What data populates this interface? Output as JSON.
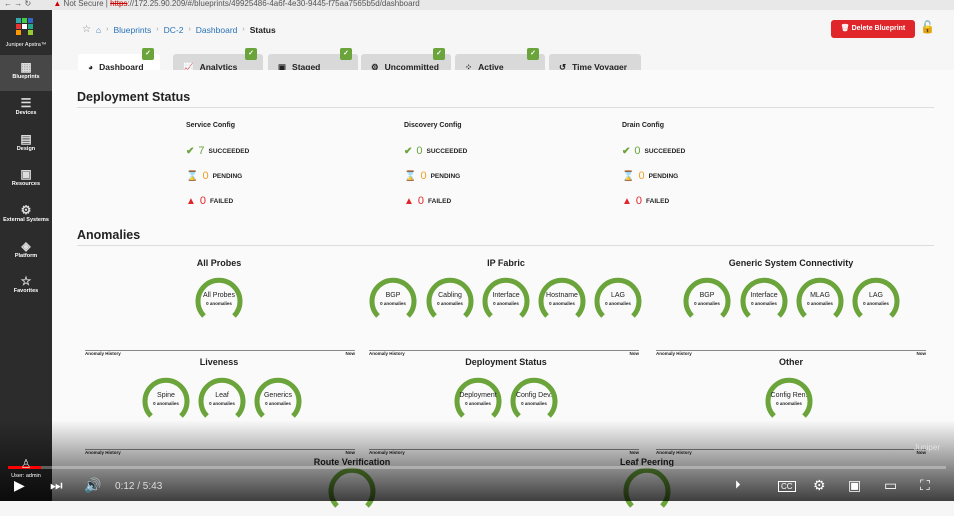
{
  "browser": {
    "not_secure": "Not Secure",
    "url_scheme": "https",
    "url_rest": "://172.25.90.209/#/blueprints/49925486-4a6f-4e30-9445-f75aa7565b5d/dashboard"
  },
  "sidebar": {
    "brand": "Juniper Apstra™",
    "items": [
      {
        "label": "Blueprints",
        "icon": "blueprints-icon"
      },
      {
        "label": "Devices",
        "icon": "devices-icon"
      },
      {
        "label": "Design",
        "icon": "design-icon"
      },
      {
        "label": "Resources",
        "icon": "resources-icon"
      },
      {
        "label": "External Systems",
        "icon": "external-systems-icon"
      },
      {
        "label": "Platform",
        "icon": "platform-icon"
      },
      {
        "label": "Favorites",
        "icon": "star-icon"
      }
    ],
    "user": "User: admin"
  },
  "breadcrumb": [
    "Blueprints",
    "DC-2",
    "Dashboard",
    "Status"
  ],
  "delete_button": "Delete Blueprint",
  "tabs": [
    {
      "label": "Dashboard",
      "badge": true
    },
    {
      "label": "Analytics",
      "badge": true
    },
    {
      "label": "Staged",
      "badge": true
    },
    {
      "label": "Uncommitted",
      "badge": true
    },
    {
      "label": "Active",
      "badge": true
    },
    {
      "label": "Time Voyager",
      "badge": false
    }
  ],
  "deployment": {
    "title": "Deployment Status",
    "columns": [
      {
        "name": "Service Config",
        "succeeded": "7",
        "pending": "0",
        "failed": "0"
      },
      {
        "name": "Discovery Config",
        "succeeded": "0",
        "pending": "0",
        "failed": "0"
      },
      {
        "name": "Drain Config",
        "succeeded": "0",
        "pending": "0",
        "failed": "0"
      }
    ],
    "labels": {
      "succeeded": "SUCCEEDED",
      "pending": "PENDING",
      "failed": "FAILED"
    }
  },
  "anomalies": {
    "title": "Anomalies",
    "sub": "0 anomalies",
    "history": "Anomaly History",
    "now": "Now",
    "groups": [
      {
        "title": "All Probes",
        "probes": [
          "All Probes"
        ]
      },
      {
        "title": "IP Fabric",
        "probes": [
          "BGP",
          "Cabling",
          "Interface",
          "Hostname",
          "LAG"
        ]
      },
      {
        "title": "Generic System Connectivity",
        "probes": [
          "BGP",
          "Interface",
          "MLAG",
          "LAG"
        ]
      },
      {
        "title": "Liveness",
        "probes": [
          "Spine",
          "Leaf",
          "Generics"
        ]
      },
      {
        "title": "Deployment Status",
        "probes": [
          "Deployment",
          "Config Dev."
        ]
      },
      {
        "title": "Other",
        "probes": [
          "Config Ren."
        ]
      },
      {
        "title": "Route Verification",
        "probes": []
      },
      {
        "title": "Leaf Peering",
        "probes": []
      }
    ]
  },
  "video": {
    "time": "0:12 / 5:43",
    "progress": 0.035,
    "watermark": "Juniper"
  },
  "colors": {
    "green": "#6aa43a",
    "red": "#e0262b",
    "amber": "#f0a020"
  }
}
